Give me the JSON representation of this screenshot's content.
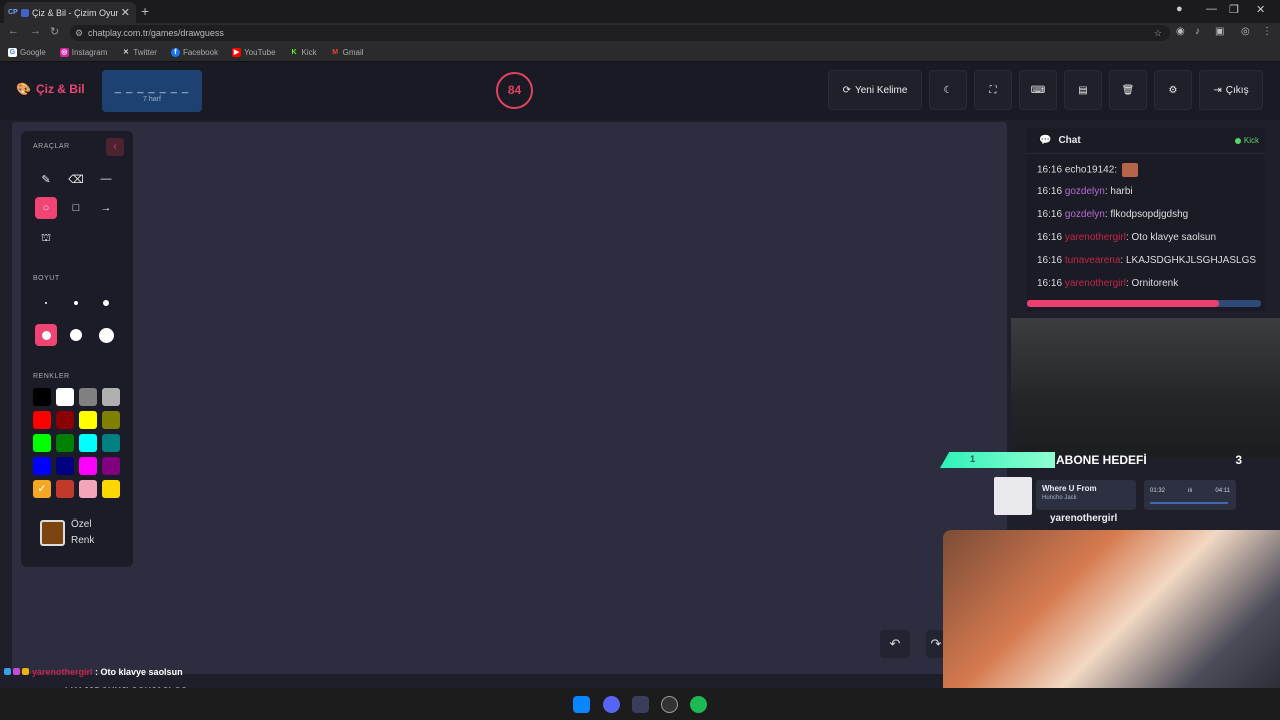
{
  "browser": {
    "tab_title": "Çiz & Bil - Çizim Oyunu",
    "tab_fav": "CP",
    "url": "chatplay.com.tr/games/drawguess",
    "bookmarks": [
      "Google",
      "Instagram",
      "Twitter",
      "Facebook",
      "YouTube",
      "Kick",
      "Gmail"
    ]
  },
  "header": {
    "logo": "Çiz & Bil",
    "word_dashes": "_ _ _ _ _ _ _",
    "word_hint": "7 harf",
    "timer": "84",
    "new_word": "Yeni Kelime",
    "exit": "Çıkış"
  },
  "tools": {
    "tools_label": "ARAÇLAR",
    "size_label": "BOYUT",
    "colors_label": "RENKLER",
    "custom_color_line1": "Özel",
    "custom_color_line2": "Renk",
    "colors": [
      "#000000",
      "#ffffff",
      "#808080",
      "#b0b0b0",
      "#ff0000",
      "#8b0000",
      "#ffff00",
      "#808000",
      "#00ff00",
      "#008000",
      "#00ffff",
      "#008080",
      "#0000ff",
      "#000080",
      "#ff00ff",
      "#800080",
      "#f5a623",
      "#c0392b",
      "#f4a6b8",
      "#ffd700"
    ],
    "custom_color": "#7b4410"
  },
  "chat": {
    "title": "Chat",
    "platform": "Kick",
    "messages": [
      {
        "time": "16:16",
        "user": "echo19142",
        "text": "",
        "color": "#dddddd"
      },
      {
        "time": "16:16",
        "user": "gozdelyn",
        "text": "harbi",
        "color": "#b46bd6"
      },
      {
        "time": "16:16",
        "user": "gozdelyn",
        "text": "flkodpsopdjgdshg",
        "color": "#b46bd6"
      },
      {
        "time": "16:16",
        "user": "yarenothergirl",
        "text": "Oto klavye saolsun",
        "color": "#c0264a"
      },
      {
        "time": "16:16",
        "user": "tunavearena",
        "text": "LKAJSDGHKJLSGHJASLGS",
        "color": "#c0264a"
      },
      {
        "time": "16:16",
        "user": "yarenothergirl",
        "text": "Ornitorenk",
        "color": "#c0264a"
      }
    ],
    "progress": 0.82
  },
  "overlay": {
    "goal_current": "1",
    "goal_label": "ABONE HEDEFİ",
    "goal_target": "3",
    "song_title": "Where U From",
    "song_artist": "Huncho Jack",
    "song_elapsed": "01:32",
    "song_total": "04:11",
    "top_user": "yarenothergirl",
    "bottom_chat": [
      {
        "user": "yarenothergirl",
        "text": "Oto klavye saolsun"
      },
      {
        "user": "tunavearena",
        "text": "LKAJSDGHKJLSGHJASLGS"
      },
      {
        "user": "yarenothergirl",
        "text": "Ornitorenk"
      }
    ]
  },
  "colors": {
    "accent": "#ef4474",
    "timer": "#e0435f",
    "word_box": "#1d4170"
  }
}
